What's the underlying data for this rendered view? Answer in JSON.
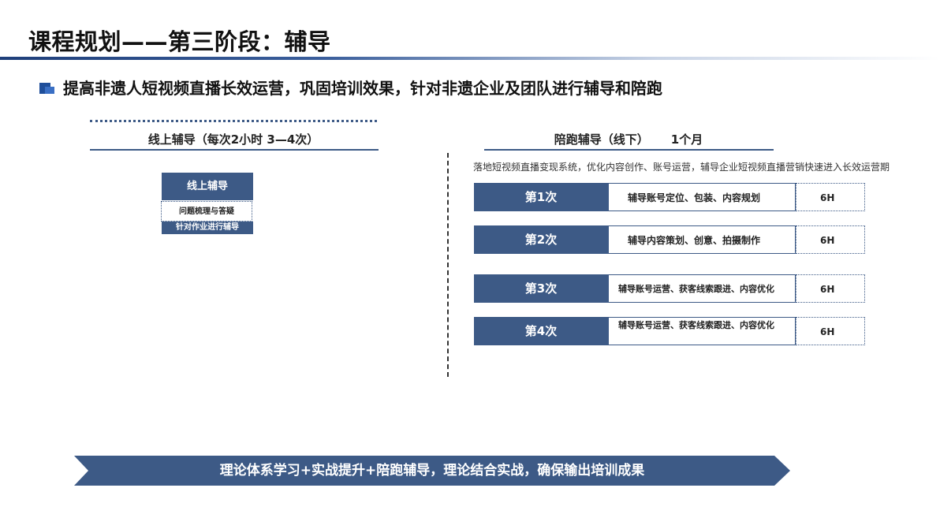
{
  "title": "课程规划——第三阶段：辅导",
  "subtitle": "提高非遗人短视频直播长效运营，巩固培训效果，针对非遗企业及团队进行辅导和陪跑",
  "left": {
    "label": "线上辅导（每次2小时 3—4次）",
    "box_title": "线上辅导",
    "box_items": [
      "问题梳理与答疑",
      "针对作业进行辅导"
    ]
  },
  "right": {
    "label_main": "陪跑辅导（线下）",
    "label_duration": "1个月",
    "description": "落地短视频直播变现系统，优化内容创作、账号运营，辅导企业短视频直播营销快速进入长效运营期",
    "sessions": [
      {
        "num": "第1次",
        "content": "辅导账号定位、包装、内容规划",
        "hours": "6H"
      },
      {
        "num": "第2次",
        "content": "辅导内容策划、创意、拍摄制作",
        "hours": "6H"
      },
      {
        "num": "第3次",
        "content": "辅导账号运营、获客线索跟进、内容优化",
        "hours": "6H"
      },
      {
        "num": "第4次",
        "content": "辅导账号运营、获客线索跟进、内容优化",
        "hours": "6H"
      }
    ]
  },
  "banner": "理论体系学习+实战提升+陪跑辅导，理论结合实战，确保输出培训成果",
  "colors": {
    "primary": "#3d5a86",
    "accent": "#1f4e9a"
  }
}
